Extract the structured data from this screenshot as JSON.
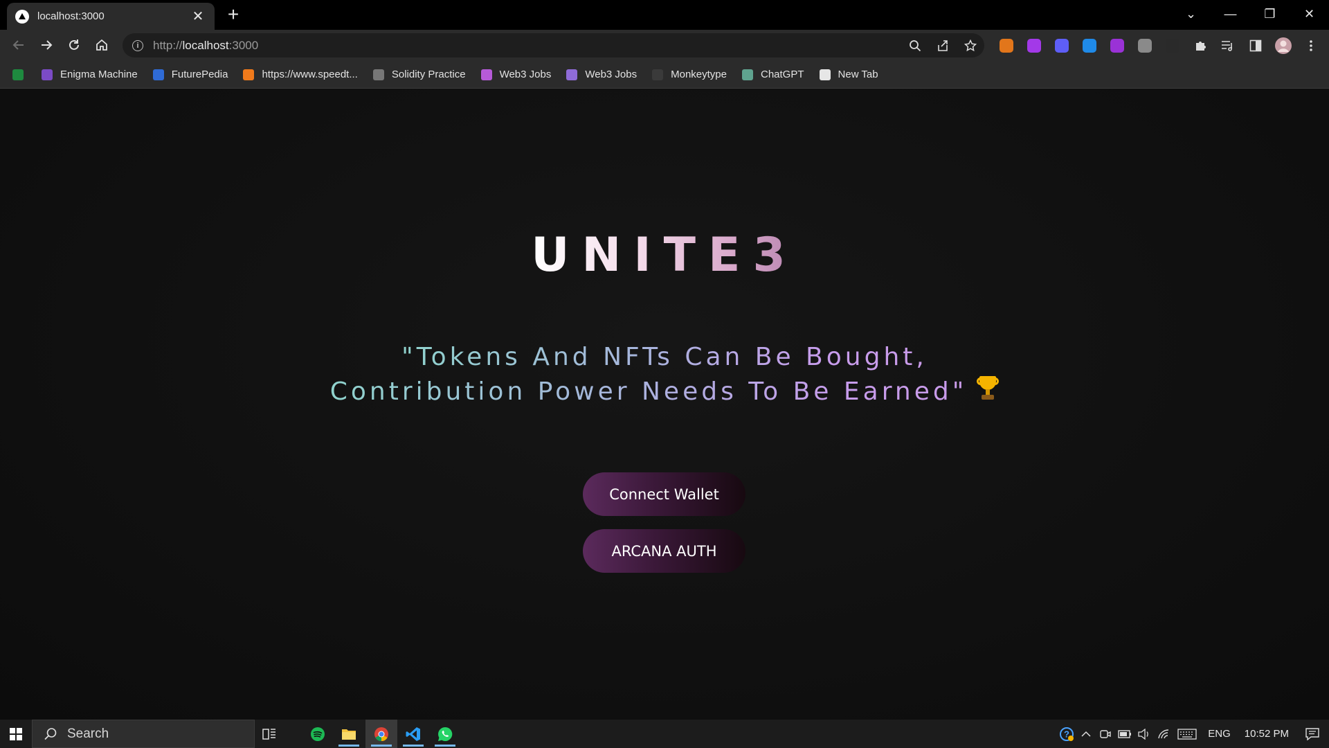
{
  "browser": {
    "tab": {
      "title": "localhost:3000",
      "close": "✕"
    },
    "new_tab": "+",
    "window_controls": {
      "dropdown": "⌄",
      "minimize": "—",
      "restore": "❐",
      "close": "✕"
    },
    "url": {
      "scheme": "http://",
      "host": "localhost",
      "port": ":3000"
    },
    "extensions": [
      {
        "name": "metamask-extension-icon",
        "color": "#e2761b"
      },
      {
        "name": "extension-purple-icon",
        "color": "#a339e8"
      },
      {
        "name": "extension-ghost-icon",
        "color": "#5e5ef7"
      },
      {
        "name": "extension-s-icon",
        "color": "#1f8ae8"
      },
      {
        "name": "extension-w-icon",
        "color": "#9a32d6"
      },
      {
        "name": "extension-grey-icon",
        "color": "#8a8a8a"
      },
      {
        "name": "extension-bird-icon",
        "color": "#2a2a2a"
      }
    ],
    "bookmarks": [
      {
        "label": "",
        "color": "#1e8a3f",
        "name": "bookmark-link-icon"
      },
      {
        "label": "Enigma Machine",
        "color": "#7b4bc6",
        "name": "bookmark-enigma-machine"
      },
      {
        "label": "FuturePedia",
        "color": "#2f6bd6",
        "name": "bookmark-futurepedia"
      },
      {
        "label": "https://www.speedt...",
        "color": "#f07a1b",
        "name": "bookmark-speedtest"
      },
      {
        "label": "Solidity Practice",
        "color": "#777777",
        "name": "bookmark-solidity-practice"
      },
      {
        "label": "Web3 Jobs",
        "color": "#b65ad9",
        "name": "bookmark-web3-jobs-1"
      },
      {
        "label": "Web3 Jobs",
        "color": "#8f6bd8",
        "name": "bookmark-web3-jobs-2"
      },
      {
        "label": "Monkeytype",
        "color": "#3a3a3a",
        "name": "bookmark-monkeytype"
      },
      {
        "label": "ChatGPT",
        "color": "#5fa38f",
        "name": "bookmark-chatgpt"
      },
      {
        "label": "New Tab",
        "color": "#e6e6e6",
        "name": "bookmark-new-tab"
      }
    ]
  },
  "page": {
    "logo": "UNITE3",
    "tagline_line1": "\"Tokens And NFTs Can Be Bought,",
    "tagline_line2": "Contribution Power Needs To Be Earned\"",
    "tagline_icon": "trophy-icon",
    "buttons": {
      "connect_wallet": "Connect Wallet",
      "arcana_auth": "ARCANA AUTH"
    }
  },
  "taskbar": {
    "search_placeholder": "Search",
    "apps": [
      "task-view-icon",
      "spotify-icon",
      "file-explorer-icon",
      "chrome-icon",
      "vscode-icon",
      "whatsapp-icon"
    ],
    "language": "ENG",
    "time": "10:52 PM"
  },
  "colors": {
    "button_gradient_start": "#5b2a5c",
    "button_gradient_end": "#170910",
    "tagline_start": "#8fd3cd",
    "tagline_end": "#c99be9"
  }
}
